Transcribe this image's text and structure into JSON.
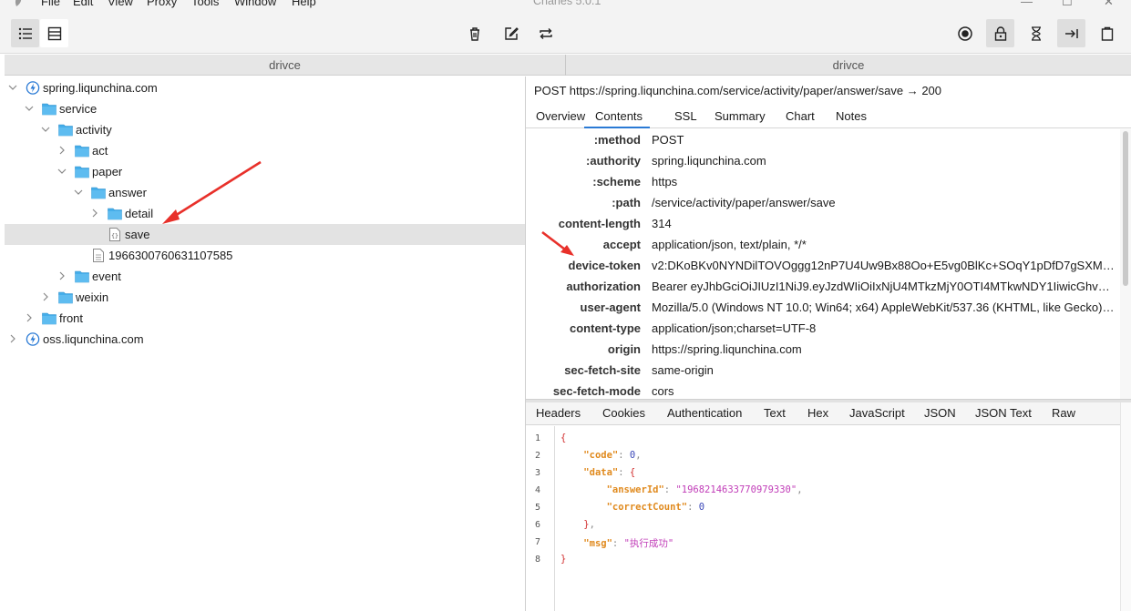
{
  "window": {
    "title": "Charles 5.0.1",
    "menus": [
      "File",
      "Edit",
      "View",
      "Proxy",
      "Tools",
      "Window",
      "Help"
    ]
  },
  "toolbar": {
    "left_icons": [
      "list-view-icon",
      "sequence-view-icon"
    ],
    "center_icons": [
      "trash-icon",
      "edit-icon",
      "repeat-icon"
    ],
    "right_icons": [
      "record-icon",
      "ssl-proxying-lock-icon",
      "throttle-hourglass-icon",
      "breakpoint-arrow-icon",
      "clipboard-icon"
    ]
  },
  "tabs": [
    "drivce",
    "drivce"
  ],
  "tree": [
    {
      "label": "spring.liqunchina.com",
      "type": "host",
      "level": 0,
      "expanded": true
    },
    {
      "label": "service",
      "type": "folder",
      "level": 1,
      "expanded": true
    },
    {
      "label": "activity",
      "type": "folder",
      "level": 2,
      "expanded": true
    },
    {
      "label": "act",
      "type": "folder",
      "level": 3,
      "expanded": false
    },
    {
      "label": "paper",
      "type": "folder",
      "level": 3,
      "expanded": true
    },
    {
      "label": "answer",
      "type": "folder",
      "level": 4,
      "expanded": true
    },
    {
      "label": "detail",
      "type": "folder",
      "level": 5,
      "expanded": false
    },
    {
      "label": "save",
      "type": "json-file",
      "level": 5,
      "selected": true
    },
    {
      "label": "1966300760631107585",
      "type": "file",
      "level": 4
    },
    {
      "label": "event",
      "type": "folder",
      "level": 3,
      "expanded": false
    },
    {
      "label": "weixin",
      "type": "folder",
      "level": 2,
      "expanded": false
    },
    {
      "label": "front",
      "type": "folder",
      "level": 1,
      "expanded": false
    },
    {
      "label": "oss.liqunchina.com",
      "type": "host",
      "level": 0,
      "expanded": false
    }
  ],
  "request": {
    "summary": "POST https://spring.liqunchina.com/service/activity/paper/answer/save  → 200"
  },
  "detail_tabs": [
    "Overview",
    "Contents",
    "SSL",
    "Summary",
    "Chart",
    "Notes"
  ],
  "detail_tab_active": "Contents",
  "headers": [
    {
      "key": ":method",
      "value": "POST"
    },
    {
      "key": ":authority",
      "value": "spring.liqunchina.com"
    },
    {
      "key": ":scheme",
      "value": "https"
    },
    {
      "key": ":path",
      "value": "/service/activity/paper/answer/save"
    },
    {
      "key": "content-length",
      "value": "314"
    },
    {
      "key": "accept",
      "value": "application/json, text/plain, */*"
    },
    {
      "key": "device-token",
      "value": "v2:DKoBKv0NYNDilTOVOggg12nP7U4Uw9Bx88Oo+E5vg0BlKc+SOqY1pDfD7gSXMlg..."
    },
    {
      "key": "authorization",
      "value": "Bearer eyJhbGciOiJIUzI1NiJ9.eyJzdWIiOiIxNjU4MTkzMjY0OTI4MTkwNDY1IiwicGhvbm..."
    },
    {
      "key": "user-agent",
      "value": "Mozilla/5.0 (Windows NT 10.0; Win64; x64) AppleWebKit/537.36 (KHTML, like Gecko) ..."
    },
    {
      "key": "content-type",
      "value": "application/json;charset=UTF-8"
    },
    {
      "key": "origin",
      "value": "https://spring.liqunchina.com"
    },
    {
      "key": "sec-fetch-site",
      "value": "same-origin"
    },
    {
      "key": "sec-fetch-mode",
      "value": "cors"
    }
  ],
  "body_tabs": [
    "Headers",
    "Cookies",
    "Authentication",
    "Text",
    "Hex",
    "JavaScript",
    "JSON",
    "JSON Text",
    "Raw"
  ],
  "code": {
    "line_numbers": [
      "1",
      "2",
      "3",
      "4",
      "5",
      "6",
      "7",
      "8"
    ],
    "lines": [
      [
        {
          "t": "{",
          "c": "brace"
        }
      ],
      [
        {
          "t": "    "
        },
        {
          "t": "\"code\"",
          "c": "key"
        },
        {
          "t": ": ",
          "c": "punc"
        },
        {
          "t": "0",
          "c": "num"
        },
        {
          "t": ",",
          "c": "punc"
        }
      ],
      [
        {
          "t": "    "
        },
        {
          "t": "\"data\"",
          "c": "key"
        },
        {
          "t": ": ",
          "c": "punc"
        },
        {
          "t": "{",
          "c": "brace"
        }
      ],
      [
        {
          "t": "        "
        },
        {
          "t": "\"answerId\"",
          "c": "key"
        },
        {
          "t": ": ",
          "c": "punc"
        },
        {
          "t": "\"1968214633770979330\"",
          "c": "str"
        },
        {
          "t": ",",
          "c": "punc"
        }
      ],
      [
        {
          "t": "        "
        },
        {
          "t": "\"correctCount\"",
          "c": "key"
        },
        {
          "t": ": ",
          "c": "punc"
        },
        {
          "t": "0",
          "c": "num"
        }
      ],
      [
        {
          "t": "    "
        },
        {
          "t": "}",
          "c": "brace"
        },
        {
          "t": ",",
          "c": "punc"
        }
      ],
      [
        {
          "t": "    "
        },
        {
          "t": "\"msg\"",
          "c": "key"
        },
        {
          "t": ": ",
          "c": "punc"
        },
        {
          "t": "\"执行成功\"",
          "c": "str"
        }
      ],
      [
        {
          "t": "}",
          "c": "brace"
        }
      ]
    ]
  },
  "colors": {
    "annotation_arrow": "#e8302a",
    "folder": "#3fa7e8",
    "active_tab_underline": "#2a7ad5"
  }
}
